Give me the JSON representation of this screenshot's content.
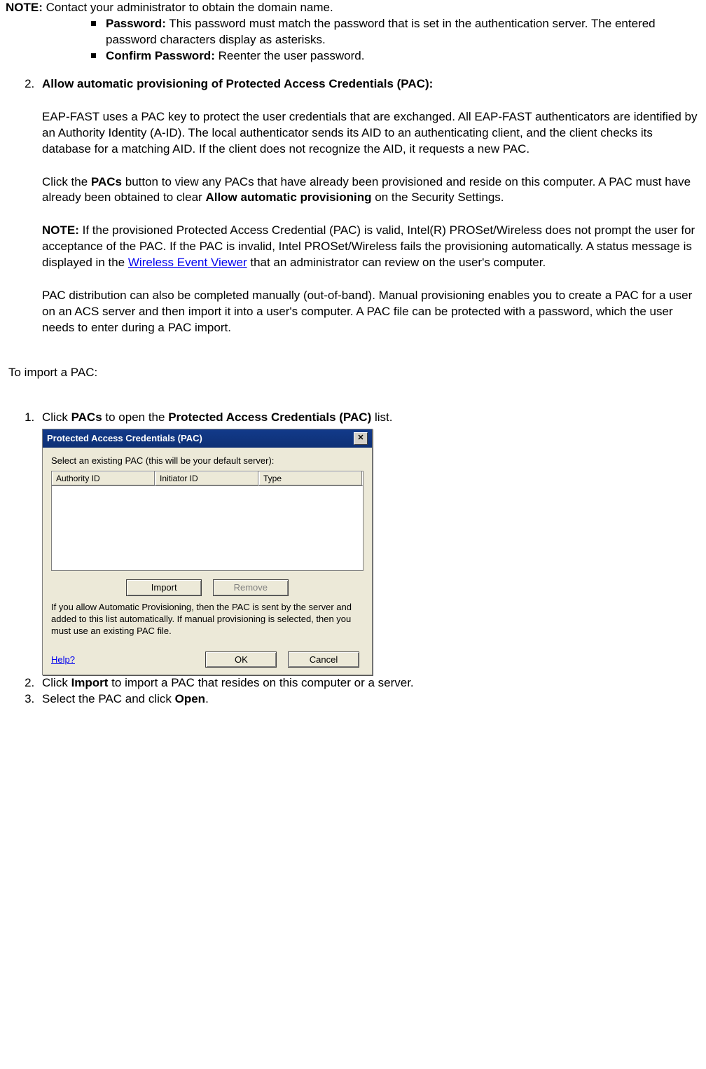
{
  "note_domain_label": "NOTE:",
  "note_domain_text": " Contact your administrator to obtain the domain name.",
  "password_label": "Password:",
  "password_text": " This password must match the password that is set in the authentication server. The entered password characters display as asterisks.",
  "confirm_label": "Confirm Password:",
  "confirm_text": " Reenter the user password.",
  "item2_heading": "Allow automatic provisioning of Protected Access Credentials (PAC):",
  "item2_p1": "EAP-FAST uses a PAC key to protect the user credentials that are exchanged. All EAP-FAST authenticators are identified by an Authority Identity (A-ID). The local authenticator sends its AID to an authenticating client, and the client checks its database for a matching AID. If the client does not recognize the AID, it requests a new PAC.",
  "item2_p2_pre": "Click the ",
  "item2_p2_b1": "PACs",
  "item2_p2_mid": " button to view any PACs that have already been provisioned and reside on this computer. A PAC must have already been obtained to clear ",
  "item2_p2_b2": "Allow automatic provisioning",
  "item2_p2_post": " on the Security Settings.",
  "item2_note_label": "NOTE:",
  "item2_note_a": " If the provisioned Protected Access Credential (PAC) is valid, Intel(R) PROSet/Wireless does not prompt the user for acceptance of the PAC. If the PAC is invalid, Intel PROSet/Wireless fails the provisioning automatically. A status message is displayed in the ",
  "item2_note_link": "Wireless Event Viewer",
  "item2_note_b": " that an administrator can review on the user's computer.",
  "item2_p4": "PAC distribution can also be completed manually (out-of-band). Manual provisioning enables you to create a PAC for a user on an ACS server and then import it into a user's computer. A PAC file can be protected with a password, which the user needs to enter during a PAC import.",
  "import_heading": "To import a PAC:",
  "import_steps": {
    "s1_pre": "Click ",
    "s1_b1": "PACs",
    "s1_mid": " to open the ",
    "s1_b2": "Protected Access Credentials (PAC)",
    "s1_post": " list.",
    "s2_pre": "Click ",
    "s2_b1": "Import",
    "s2_post": " to import a PAC that resides on this computer or a server.",
    "s3_pre": "Select the PAC and click ",
    "s3_b1": "Open",
    "s3_post": "."
  },
  "dialog": {
    "title": "Protected Access Credentials (PAC)",
    "select_label": "Select an existing PAC (this will be your default server):",
    "col1": "Authority ID",
    "col2": "Initiator ID",
    "col3": "Type",
    "btn_import": "Import",
    "btn_remove": "Remove",
    "note": "If you allow Automatic Provisioning, then the PAC is sent by the server and added to this list automatically.  If manual provisioning is selected, then you must use an existing PAC file.",
    "help": "Help?",
    "ok": "OK",
    "cancel": "Cancel"
  }
}
